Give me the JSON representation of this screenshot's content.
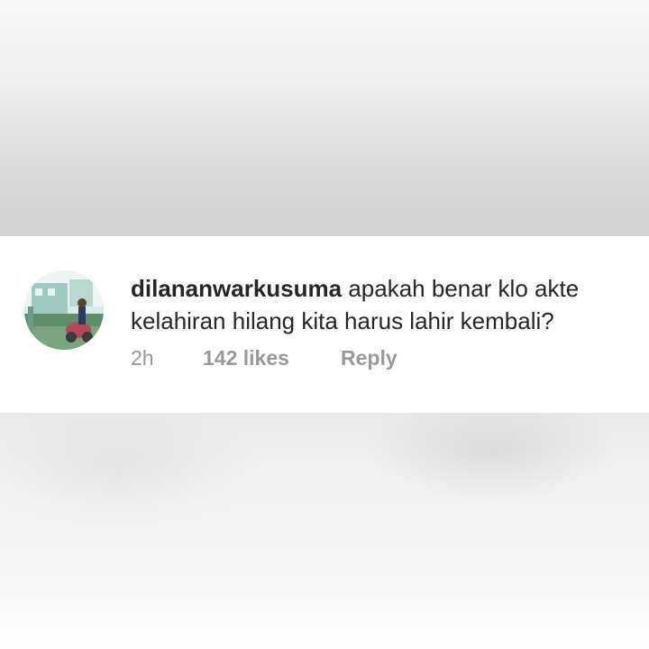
{
  "comment": {
    "avatar": "user-avatar-photo",
    "username": "dilananwarkusuma",
    "text": "apakah  benar klo akte kelahiran hilang kita harus lahir kembali?",
    "time": "2h",
    "likes": "142 likes",
    "reply_label": "Reply"
  },
  "colors": {
    "username": "#262626",
    "text": "#262626",
    "meta": "#999999",
    "background": "#ffffff"
  }
}
